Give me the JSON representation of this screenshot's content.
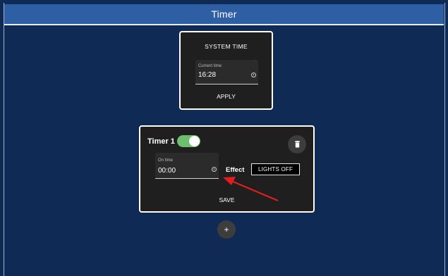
{
  "header": {
    "title": "Timer"
  },
  "system_time": {
    "title": "SYSTEM TIME",
    "field_label": "Current time",
    "value": "16:28",
    "apply_label": "APPLY"
  },
  "timer": {
    "name": "Timer 1",
    "enabled": true,
    "field_label": "On time",
    "value": "00:00",
    "effect_label": "Effect",
    "effect_value": "LIGHTS OFF",
    "save_label": "SAVE",
    "delete_icon": "trash-icon"
  },
  "add_button": {
    "label": "+"
  },
  "colors": {
    "background": "#0f2b55",
    "header": "#2e5ea3",
    "card": "#1f1f1f",
    "toggle_on": "#6cbf6c",
    "annotation_arrow": "#e01e1e"
  }
}
